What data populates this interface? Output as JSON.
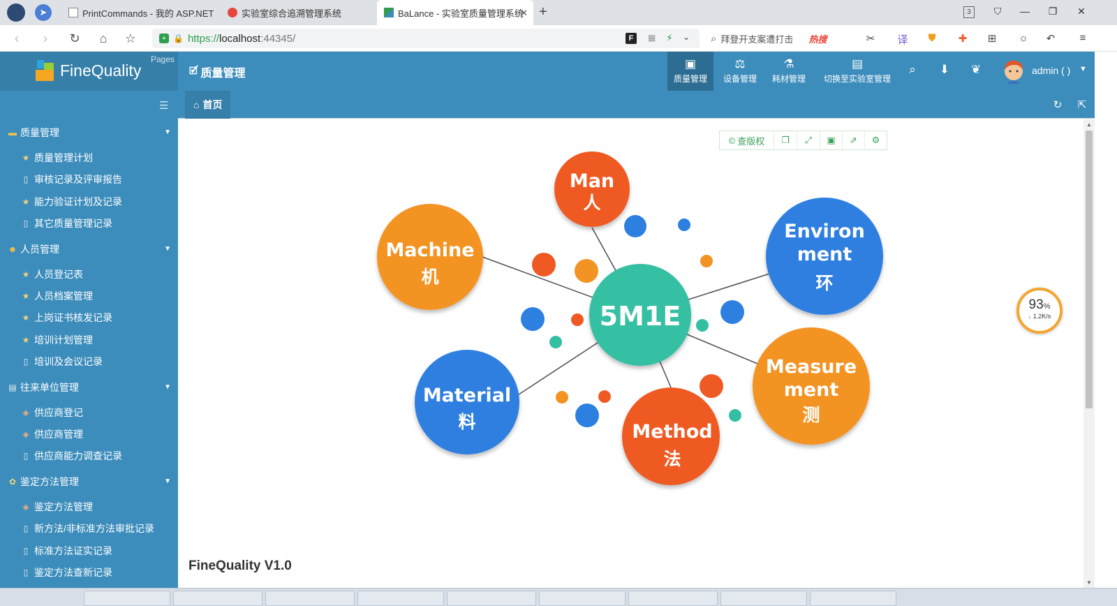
{
  "browser": {
    "tabs": [
      {
        "title": "PrintCommands - 我的 ASP.NET"
      },
      {
        "title": "实验室综合追溯管理系统"
      },
      {
        "title": "BaLance - 实验室质量管理系统"
      }
    ],
    "new_tab": "+",
    "tab_count": "3",
    "url": {
      "protocol": "https://",
      "host": "localhost",
      "port": ":44345/"
    },
    "search_text": "拜登开支案遭打击",
    "hot_label": "热搜"
  },
  "header": {
    "app_name": "FineQuality",
    "pages_label": "Pages",
    "module_title": "质量管理",
    "nav": [
      {
        "label": "质量管理",
        "icon": "calendar-check-icon",
        "active": true
      },
      {
        "label": "设备管理",
        "icon": "scale-icon",
        "active": false
      },
      {
        "label": "耗材管理",
        "icon": "flask-icon",
        "active": false
      },
      {
        "label": "切换至实验室管理",
        "icon": "building-icon",
        "active": false
      }
    ],
    "user_label": "admin ( )"
  },
  "sidebar": {
    "groups": [
      {
        "label": "质量管理",
        "items": [
          "质量管理计划",
          "审核记录及评审报告",
          "能力验证计划及记录",
          "其它质量管理记录"
        ]
      },
      {
        "label": "人员管理",
        "items": [
          "人员登记表",
          "人员档案管理",
          "上岗证书核发记录",
          "培训计划管理",
          "培训及会议记录"
        ]
      },
      {
        "label": "往来单位管理",
        "items": [
          "供应商登记",
          "供应商管理",
          "供应商能力调查记录"
        ]
      },
      {
        "label": "鉴定方法管理",
        "items": [
          "鉴定方法管理",
          "新方法/非标准方法审批记录",
          "标准方法证实记录",
          "鉴定方法查新记录"
        ]
      }
    ]
  },
  "content": {
    "home_tab": "首页",
    "toolbox": {
      "copyright_label": "查版权"
    },
    "diagram": {
      "center": "5M1E",
      "nodes": [
        {
          "id": "man",
          "lines": [
            "Man",
            "人"
          ],
          "color": "#ef5a24"
        },
        {
          "id": "machine",
          "lines": [
            "Machine",
            "机"
          ],
          "color": "#f39324"
        },
        {
          "id": "environment",
          "lines": [
            "Environ",
            "ment",
            "环"
          ],
          "color": "#2d7fe0"
        },
        {
          "id": "measurement",
          "lines": [
            "Measure",
            "ment",
            "测"
          ],
          "color": "#f39324"
        },
        {
          "id": "method",
          "lines": [
            "Method",
            "法"
          ],
          "color": "#ef5a24"
        },
        {
          "id": "material",
          "lines": [
            "Material",
            "料"
          ],
          "color": "#2d7fe0"
        }
      ],
      "center_color": "#34bfa3"
    },
    "version": "FineQuality V1.0"
  },
  "speed_widget": {
    "percent": "93",
    "percent_unit": "%",
    "rate": "1.2K/s",
    "arrow": "↓"
  }
}
